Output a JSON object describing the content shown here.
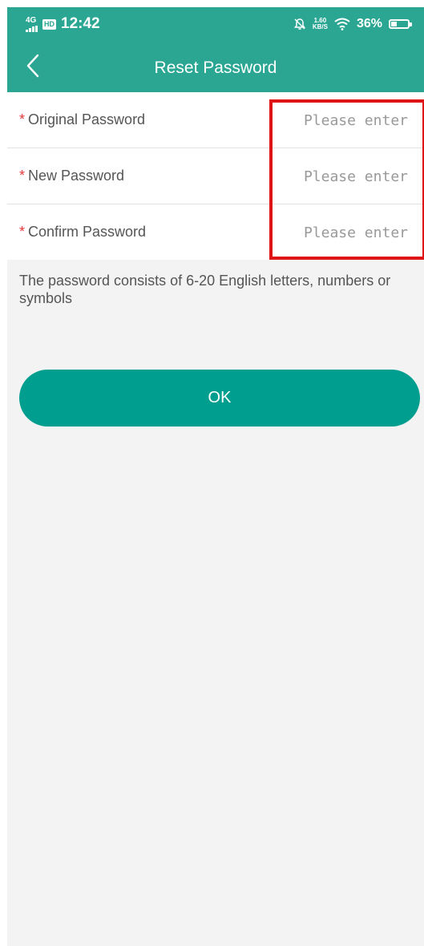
{
  "status_bar": {
    "network": "4G",
    "hd": "HD",
    "time": "12:42",
    "speed_value": "1.60",
    "speed_unit": "KB/S",
    "battery": "36%",
    "battery_level": 0.36
  },
  "nav": {
    "title": "Reset Password"
  },
  "form": {
    "fields": [
      {
        "label": "Original Password",
        "placeholder": "Please enter",
        "required_mark": "*"
      },
      {
        "label": "New Password",
        "placeholder": "Please enter",
        "required_mark": "*"
      },
      {
        "label": "Confirm Password",
        "placeholder": "Please enter",
        "required_mark": "*"
      }
    ]
  },
  "hint": "The password consists of 6-20 English letters, numbers or symbols",
  "ok_label": "OK",
  "colors": {
    "header": "#2aa693",
    "button": "#009e8f",
    "required": "#e33b3b",
    "highlight": "#e01414"
  }
}
